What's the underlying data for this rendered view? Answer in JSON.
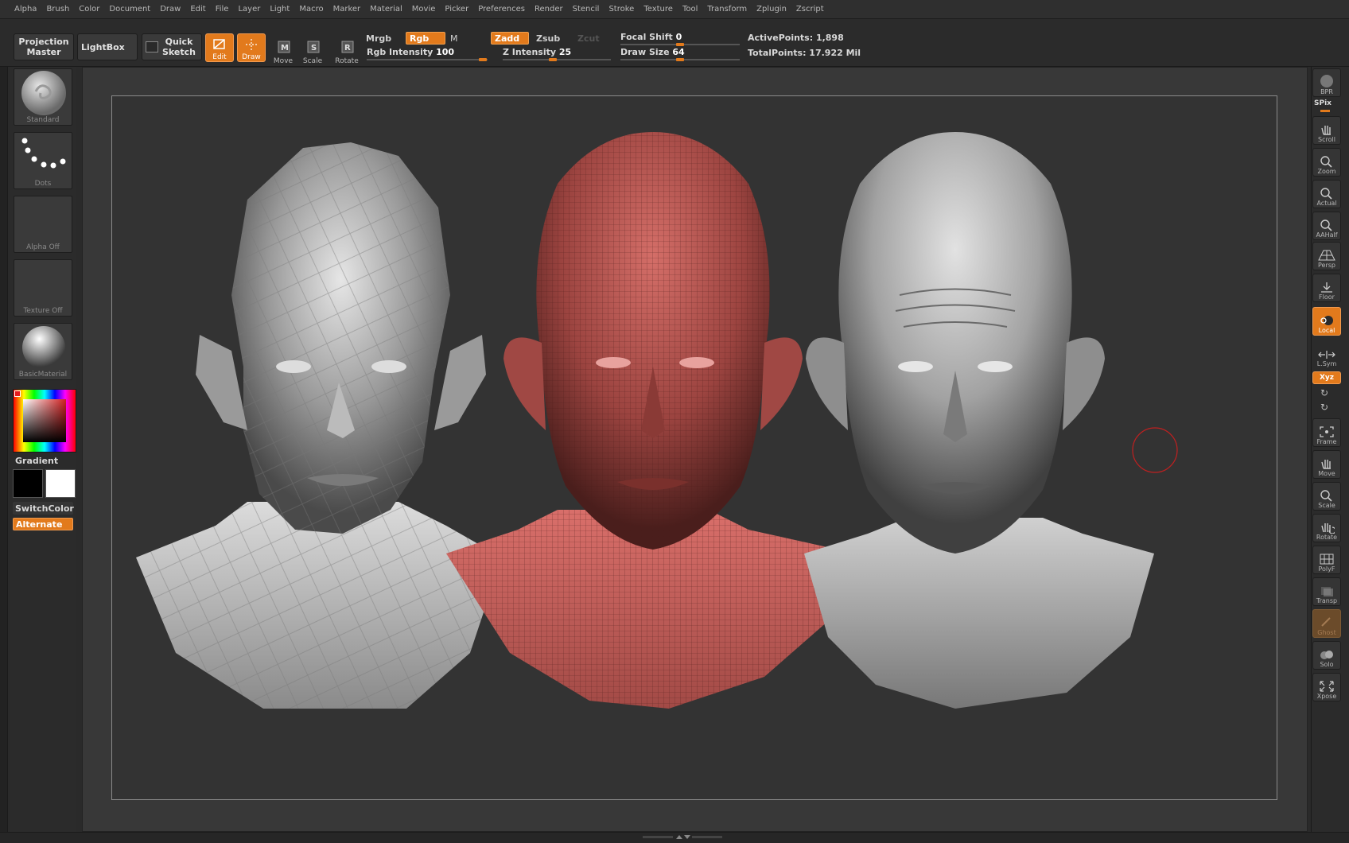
{
  "menu": [
    "Alpha",
    "Brush",
    "Color",
    "Document",
    "Draw",
    "Edit",
    "File",
    "Layer",
    "Light",
    "Macro",
    "Marker",
    "Material",
    "Movie",
    "Picker",
    "Preferences",
    "Render",
    "Stencil",
    "Stroke",
    "Texture",
    "Tool",
    "Transform",
    "Zplugin",
    "Zscript"
  ],
  "toolbar": {
    "projection_master_line1": "Projection",
    "projection_master_line2": "Master",
    "lightbox": "LightBox",
    "quick_sketch_line1": "Quick",
    "quick_sketch_line2": "Sketch",
    "edit": "Edit",
    "draw": "Draw",
    "move": "Move",
    "scale": "Scale",
    "rotate": "Rotate",
    "mrgb": "Mrgb",
    "rgb": "Rgb",
    "m": "M",
    "zadd": "Zadd",
    "zsub": "Zsub",
    "zcut": "Zcut",
    "rgb_intensity_label": "Rgb  Intensity",
    "rgb_intensity_value": "100",
    "z_intensity_label": "Z  Intensity",
    "z_intensity_value": "25",
    "focal_shift_label": "Focal  Shift",
    "focal_shift_value": "0",
    "draw_size_label": "Draw  Size",
    "draw_size_value": "64",
    "active_points": "ActivePoints: 1,898",
    "total_points": "TotalPoints: 17.922 Mil"
  },
  "left_shelf": {
    "brush": "Standard",
    "stroke": "Dots",
    "alpha": "Alpha  Off",
    "texture": "Texture  Off",
    "material": "BasicMaterial",
    "gradient": "Gradient",
    "switch_color": "SwitchColor",
    "alternate": "Alternate"
  },
  "right_shelf": {
    "bpr": "BPR",
    "spix": "SPix",
    "scroll": "Scroll",
    "zoom": "Zoom",
    "actual": "Actual",
    "aahalf": "AAHalf",
    "persp": "Persp",
    "floor": "Floor",
    "local": "Local",
    "lsym": "L.Sym",
    "xyz": "Xyz",
    "frame": "Frame",
    "move": "Move",
    "scale": "Scale",
    "rotate": "Rotate",
    "polyf": "PolyF",
    "transp": "Transp",
    "ghost": "Ghost",
    "solo": "Solo",
    "xpose": "Xpose"
  },
  "colors": {
    "accent": "#e27a1c",
    "panel": "#2b2b2b",
    "canvas": "#333333",
    "head_red": "#c8605c",
    "head_gray": "#b8b8b8"
  }
}
